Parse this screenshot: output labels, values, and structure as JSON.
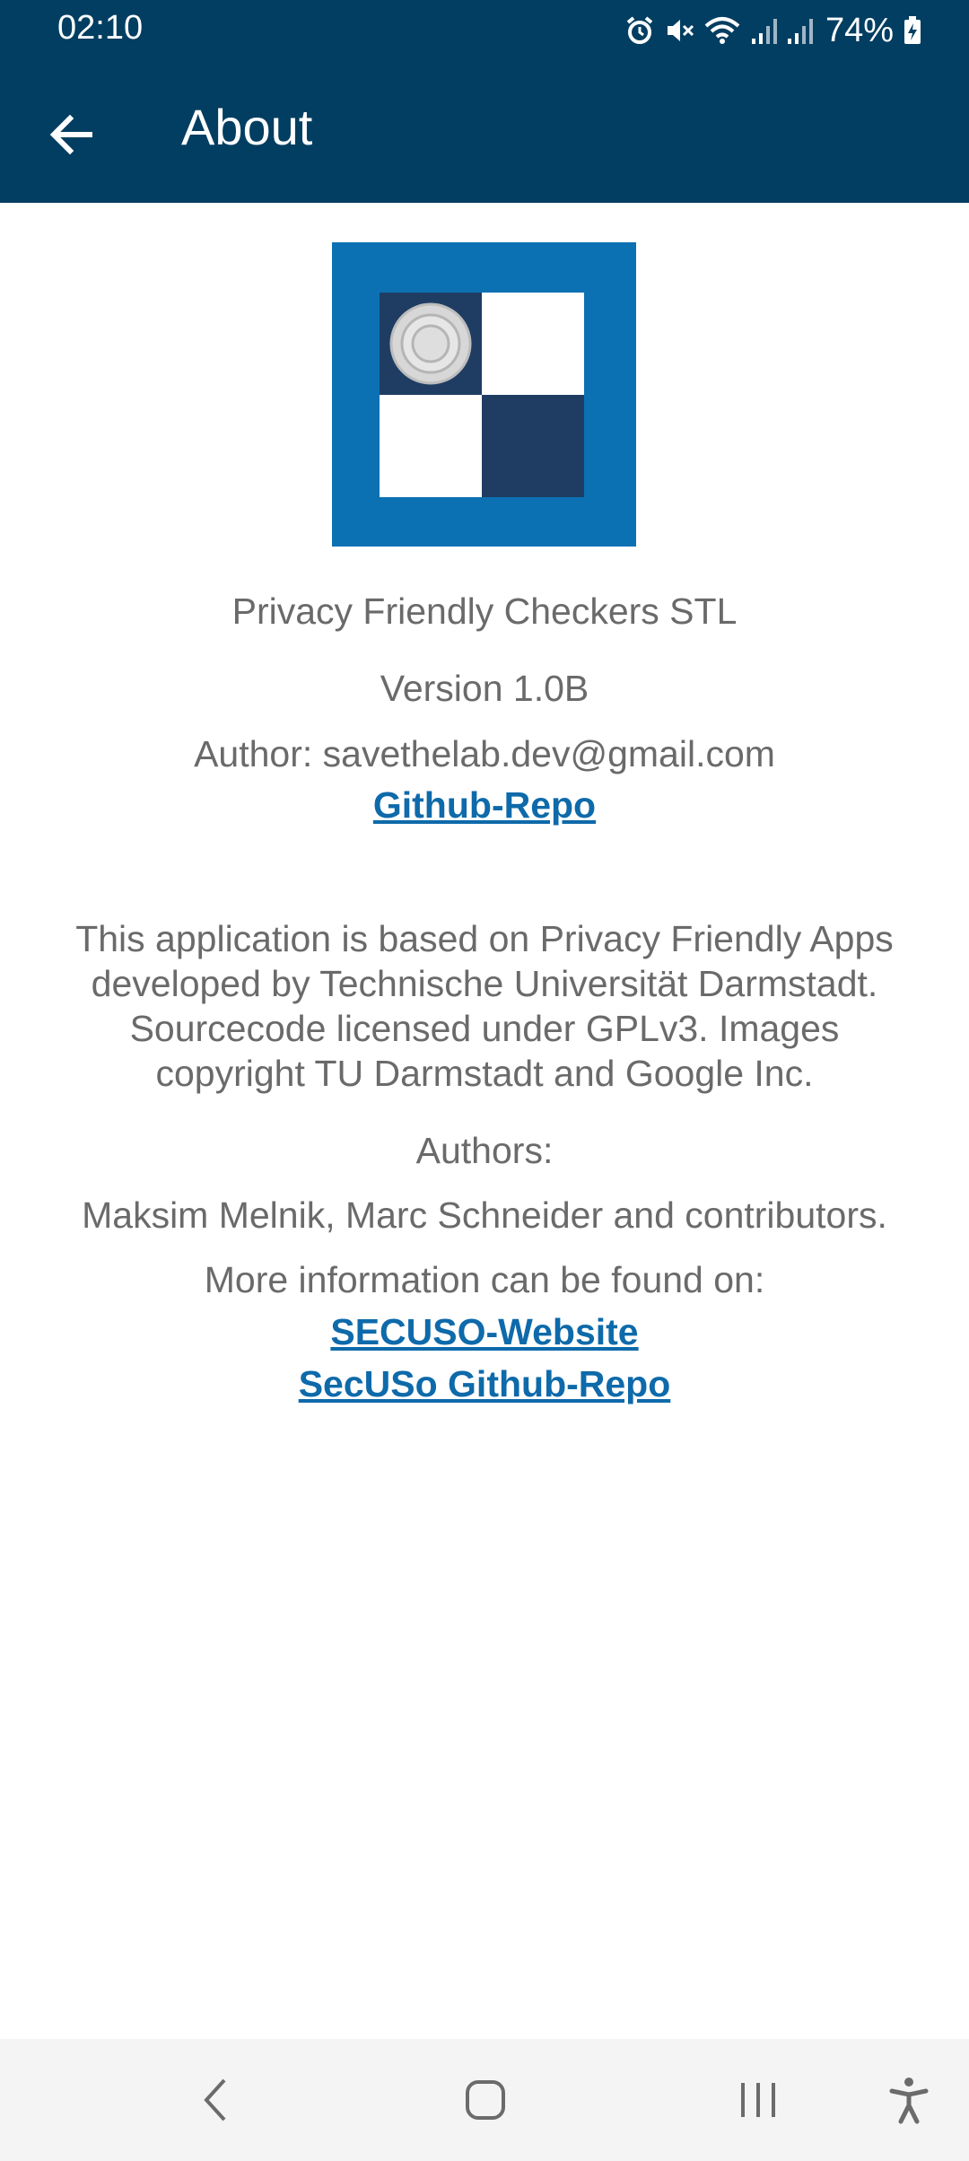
{
  "status_bar": {
    "time": "02:10",
    "battery": "74%",
    "icons": [
      "alarm-icon",
      "mute-icon",
      "wifi-icon",
      "signal-icon",
      "signal-icon",
      "battery-charging-icon"
    ]
  },
  "app_bar": {
    "title": "About",
    "back_icon": "arrow-back-icon"
  },
  "about": {
    "app_name": "Privacy Friendly Checkers STL",
    "version": "Version 1.0B",
    "author": "Author: savethelab.dev@gmail.com",
    "github_link": "Github-Repo",
    "description_lines": [
      "This application is based on Privacy Friendly Apps",
      "developed by Technische Universität Darmstadt.",
      "Sourcecode licensed under GPLv3. Images",
      "copyright TU Darmstadt and Google Inc."
    ],
    "authors_label": "Authors:",
    "authors": "Maksim Melnik, Marc Schneider and contributors.",
    "more_info": "More information can be found on:",
    "secuso_website_link": "SECUSO-Website",
    "secuso_github_link": "SecUSo Github-Repo"
  },
  "nav_bar": {
    "icons": [
      "back-nav-icon",
      "home-nav-icon",
      "recents-nav-icon",
      "accessibility-icon"
    ]
  },
  "colors": {
    "primary_dark": "#023e61",
    "logo_blue": "#0c71b3",
    "logo_dark": "#1f3d63",
    "link": "#0e6aaa",
    "body_text": "#6a6a6a"
  }
}
